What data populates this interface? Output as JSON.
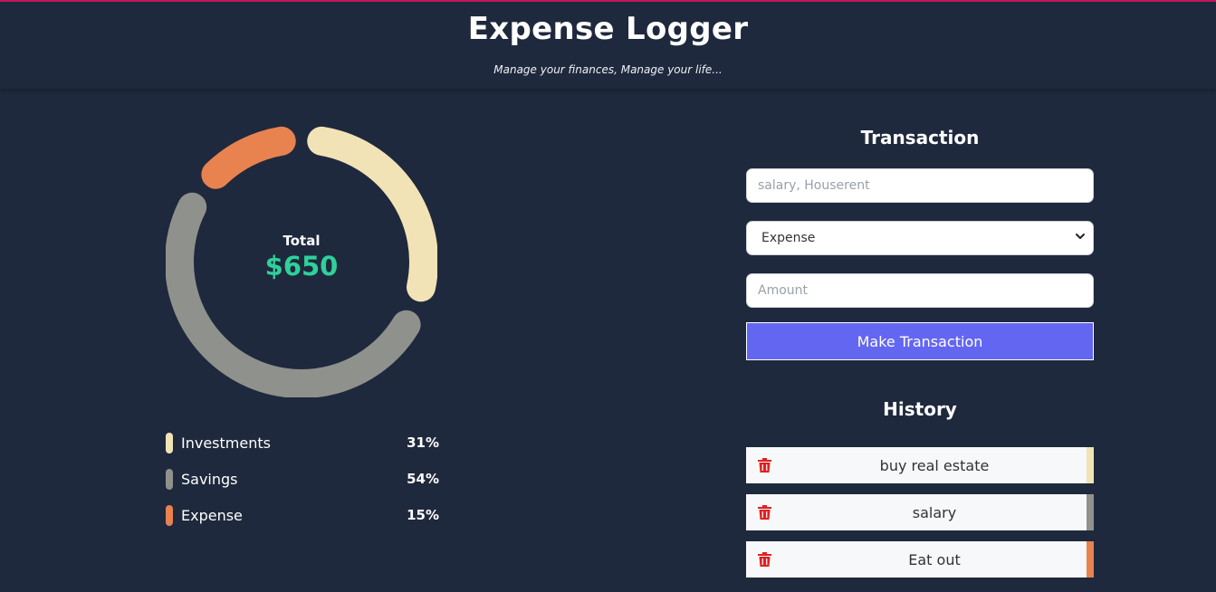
{
  "header": {
    "title": "Expense Logger",
    "subtitle": "Manage your finances, Manage your life..."
  },
  "summary": {
    "total_label": "Total",
    "total_value": "$650"
  },
  "chart_data": {
    "type": "pie",
    "variant": "donut",
    "categories": [
      "Investments",
      "Savings",
      "Expense"
    ],
    "values": [
      31,
      54,
      15
    ],
    "value_labels": [
      "31%",
      "54%",
      "15%"
    ],
    "colors": [
      "#f2e3b6",
      "#8f918c",
      "#e8824f"
    ],
    "legend_placement": "bottom"
  },
  "transaction": {
    "title": "Transaction",
    "description_placeholder": "salary, Houserent",
    "type_selected": "Expense",
    "amount_placeholder": "Amount",
    "submit_label": "Make Transaction"
  },
  "history": {
    "title": "History",
    "items": [
      {
        "label": "buy real estate",
        "icon": "trash-icon",
        "color": "#f2e3b6"
      },
      {
        "label": "salary",
        "icon": "trash-icon",
        "color": "#8f918c"
      },
      {
        "label": "Eat out",
        "icon": "trash-icon",
        "color": "#e8824f"
      }
    ]
  },
  "colors": {
    "background": "#1f293d",
    "accent_button": "#6366f1",
    "total_green": "#2fd09a",
    "delete_red": "#e02020",
    "top_border": "#c2185b"
  }
}
